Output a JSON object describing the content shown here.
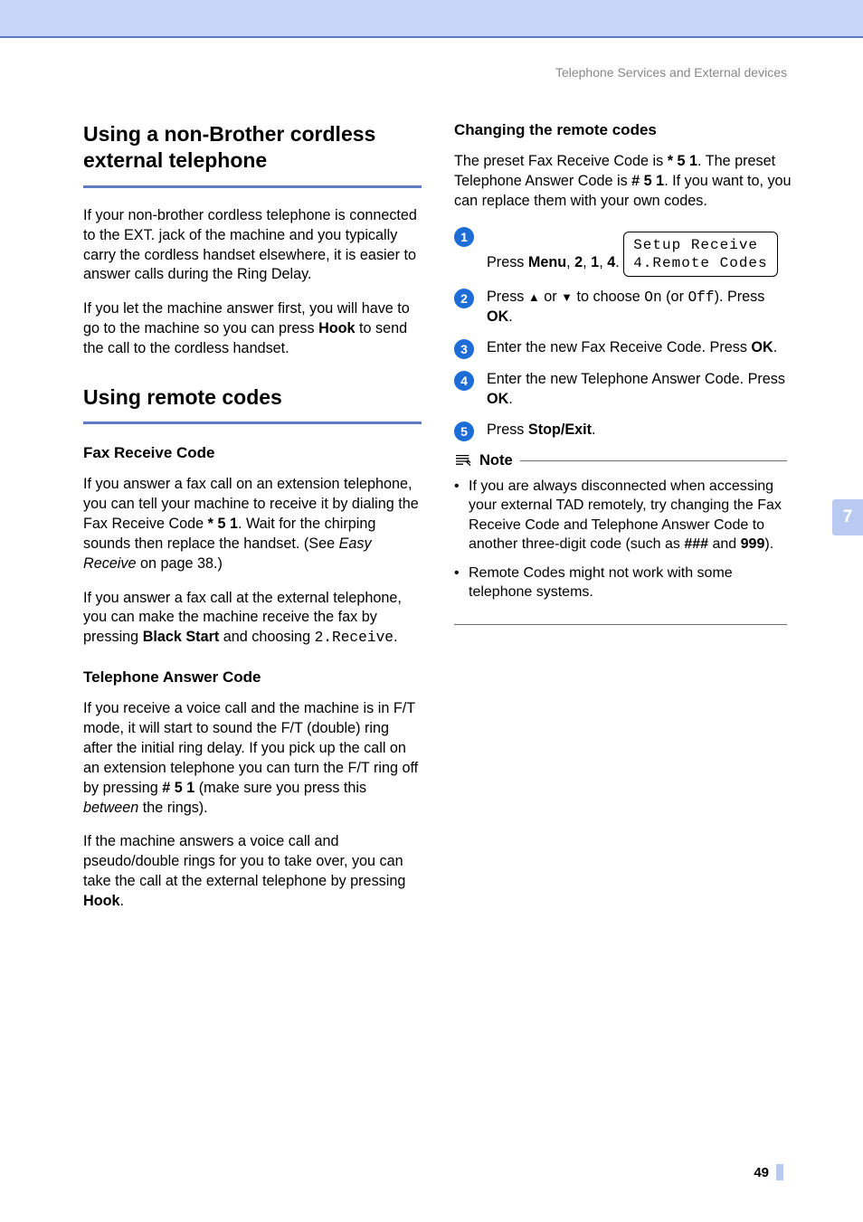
{
  "breadcrumb": "Telephone Services and External devices",
  "chapter_tab": "7",
  "page_number": "49",
  "left": {
    "h_nonbrother": "Using a non-Brother cordless external telephone",
    "p_nb1": "If your non-brother cordless telephone is connected to the EXT. jack of the machine and you typically carry the cordless handset elsewhere, it is easier to answer calls during the Ring Delay.",
    "p_nb2_pre": "If you let the machine answer first, you will have to go to the machine so you can press ",
    "p_nb2_bold": "Hook",
    "p_nb2_post": " to send the call to the cordless handset.",
    "h_remote": "Using remote codes",
    "h_fax": "Fax Receive Code",
    "fax_p1_pre": "If you answer a fax call on an extension telephone, you can tell your machine to receive it by dialing the Fax Receive Code ",
    "fax_p1_code": "* 5 1",
    "fax_p1_mid": ". Wait for the chirping sounds then replace the handset. (See ",
    "fax_p1_link": "Easy Receive",
    "fax_p1_post": " on page 38.)",
    "fax_p2_pre": "If you answer a fax call at the external telephone, you can make the machine receive the fax by pressing ",
    "fax_p2_bold": "Black Start",
    "fax_p2_mid": " and choosing ",
    "fax_p2_mono": "2.Receive",
    "fax_p2_post": ".",
    "h_tel": "Telephone Answer Code",
    "tel_p1_pre": "If you receive a voice call and the machine is in F/T mode, it will start to sound the F/T (double) ring after the initial ring delay. If you pick up the call on an extension telephone you can turn the F/T ring off by pressing ",
    "tel_p1_bold": "# 5 1",
    "tel_p1_mid": " (make sure you press this ",
    "tel_p1_ital": "between",
    "tel_p1_post": " the rings).",
    "tel_p2_pre": "If the machine answers a voice call and pseudo/double rings for you to take over, you can take the call at the external telephone by pressing ",
    "tel_p2_bold": "Hook",
    "tel_p2_post": "."
  },
  "right": {
    "h_change": "Changing the remote codes",
    "intro_pre": "The preset Fax Receive Code is ",
    "intro_code1": "* 5 1",
    "intro_mid1": ". The preset Telephone Answer Code is ",
    "intro_code2": "# 5 1",
    "intro_post": ". If you want to, you can replace them with your own codes.",
    "steps": {
      "s1_pre": "Press ",
      "s1_b1": "Menu",
      "s1_sep1": ", ",
      "s1_b2": "2",
      "s1_sep2": ", ",
      "s1_b3": "1",
      "s1_sep3": ", ",
      "s1_b4": "4",
      "s1_post": ".",
      "lcd": "Setup Receive\n4.Remote Codes",
      "s2_pre": "Press ",
      "s2_a1": "▲",
      "s2_mid1": " or ",
      "s2_a2": "▼",
      "s2_mid2": " to choose ",
      "s2_m1": "On",
      "s2_mid3": " (or ",
      "s2_m2": "Off",
      "s2_mid4": "). Press ",
      "s2_b": "OK",
      "s2_post": ".",
      "s3_pre": "Enter the new Fax Receive Code. Press ",
      "s3_b": "OK",
      "s3_post": ".",
      "s4_pre": "Enter the new Telephone Answer Code. Press ",
      "s4_b": "OK",
      "s4_post": ".",
      "s5_pre": "Press ",
      "s5_b": "Stop/Exit",
      "s5_post": "."
    },
    "note_title": "Note",
    "note1_pre": "If you are always disconnected when accessing your external TAD remotely, try changing the Fax Receive Code and Telephone Answer Code to another three-digit code (such as ",
    "note1_b1": "###",
    "note1_mid": " and ",
    "note1_b2": "999",
    "note1_post": ").",
    "note2": "Remote Codes might not work with some telephone systems."
  }
}
